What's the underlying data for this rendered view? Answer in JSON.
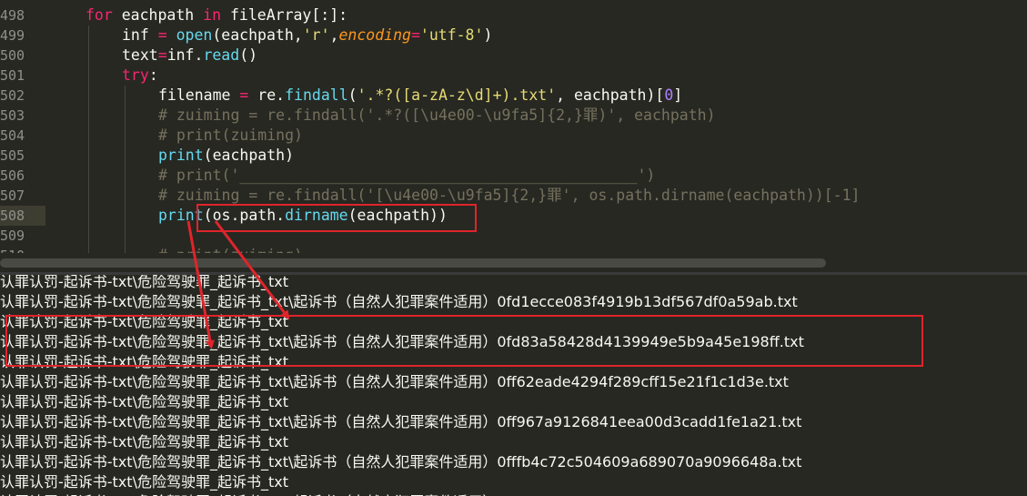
{
  "editor": {
    "lines": [
      {
        "num": "498",
        "segs": [
          [
            "kw",
            "for"
          ],
          [
            "txt",
            " eachpath "
          ],
          [
            "kw",
            "in"
          ],
          [
            "txt",
            " fileArray[:]:"
          ]
        ],
        "indent": 0
      },
      {
        "num": "499",
        "segs": [
          [
            "txt",
            "inf "
          ],
          [
            "kw",
            "="
          ],
          [
            "txt",
            " "
          ],
          [
            "fn",
            "open"
          ],
          [
            "txt",
            "(eachpath,"
          ],
          [
            "str",
            "'r'"
          ],
          [
            "txt",
            ","
          ],
          [
            "param",
            "encoding"
          ],
          [
            "kw",
            "="
          ],
          [
            "str",
            "'utf-8'"
          ],
          [
            "txt",
            ")"
          ]
        ],
        "indent": 1
      },
      {
        "num": "500",
        "segs": [
          [
            "txt",
            "text"
          ],
          [
            "kw",
            "="
          ],
          [
            "txt",
            "inf."
          ],
          [
            "fn",
            "read"
          ],
          [
            "txt",
            "()"
          ]
        ],
        "indent": 1
      },
      {
        "num": "501",
        "segs": [
          [
            "kw",
            "try"
          ],
          [
            "txt",
            ":"
          ]
        ],
        "indent": 1
      },
      {
        "num": "502",
        "segs": [
          [
            "txt",
            "filename "
          ],
          [
            "kw",
            "="
          ],
          [
            "txt",
            " re."
          ],
          [
            "fn",
            "findall"
          ],
          [
            "txt",
            "("
          ],
          [
            "str",
            "'.*?([a-zA-z\\d]+).txt'"
          ],
          [
            "txt",
            ", eachpath)["
          ],
          [
            "num",
            "0"
          ],
          [
            "txt",
            "]"
          ]
        ],
        "indent": 2
      },
      {
        "num": "503",
        "segs": [
          [
            "cmt",
            "# zuiming = re.findall('.*?([\\u4e00-\\u9fa5]{2,}罪)', eachpath)"
          ]
        ],
        "indent": 2
      },
      {
        "num": "504",
        "segs": [
          [
            "cmt",
            "# print(zuiming)"
          ]
        ],
        "indent": 2
      },
      {
        "num": "505",
        "segs": [
          [
            "fn",
            "print"
          ],
          [
            "txt",
            "(eachpath)"
          ]
        ],
        "indent": 2
      },
      {
        "num": "506",
        "segs": [
          [
            "cmt",
            "# print('____________________________________________')"
          ]
        ],
        "indent": 2
      },
      {
        "num": "507",
        "segs": [
          [
            "cmt",
            "# zuiming = re.findall('[\\u4e00-\\u9fa5]{2,}罪', os.path.dirname(eachpath))[-1]"
          ]
        ],
        "indent": 2
      },
      {
        "num": "508",
        "segs": [
          [
            "fn",
            "print"
          ],
          [
            "txt",
            "(os.path."
          ],
          [
            "fn",
            "dirname"
          ],
          [
            "txt",
            "(eachpath))"
          ]
        ],
        "indent": 2,
        "active": true
      },
      {
        "num": "509",
        "segs": [],
        "indent": 2
      },
      {
        "num": "510",
        "segs": [
          [
            "cmt",
            "# print(zuiming)"
          ]
        ],
        "indent": 2
      }
    ]
  },
  "console": {
    "lines": [
      "认罪认罚-起诉书-txt\\危险驾驶罪_起诉书_txt",
      "认罪认罚-起诉书-txt\\危险驾驶罪_起诉书_txt\\起诉书（自然人犯罪案件适用）0fd1ecce083f4919b13df567df0a59ab.txt",
      "认罪认罚-起诉书-txt\\危险驾驶罪_起诉书_txt",
      "认罪认罚-起诉书-txt\\危险驾驶罪_起诉书_txt\\起诉书（自然人犯罪案件适用）0fd83a58428d4139949e5b9a45e198ff.txt",
      "认罪认罚-起诉书-txt\\危险驾驶罪_起诉书_txt",
      "认罪认罚-起诉书-txt\\危险驾驶罪_起诉书_txt\\起诉书（自然人犯罪案件适用）0ff62eade4294f289cff15e21f1c1d3e.txt",
      "认罪认罚-起诉书-txt\\危险驾驶罪_起诉书_txt",
      "认罪认罚-起诉书-txt\\危险驾驶罪_起诉书_txt\\起诉书（自然人犯罪案件适用）0ff967a9126841eea00d3cadd1fe1a21.txt",
      "认罪认罚-起诉书-txt\\危险驾驶罪_起诉书_txt",
      "认罪认罚-起诉书-txt\\危险驾驶罪_起诉书_txt\\起诉书（自然人犯罪案件适用）0fffb4c72c504609a689070a9096648a.txt",
      "认罪认罚-起诉书-txt\\危险驾驶罪_起诉书_txt",
      "认罪认罚-起诉书-txt\\危险驾驶罪_起诉书_txt\\起诉书（自然人犯罪案件适用）1000842aa49e461088aa3780a71125a1.txt"
    ]
  },
  "colors": {
    "background": "#272822",
    "annotation": "#e0242b"
  }
}
